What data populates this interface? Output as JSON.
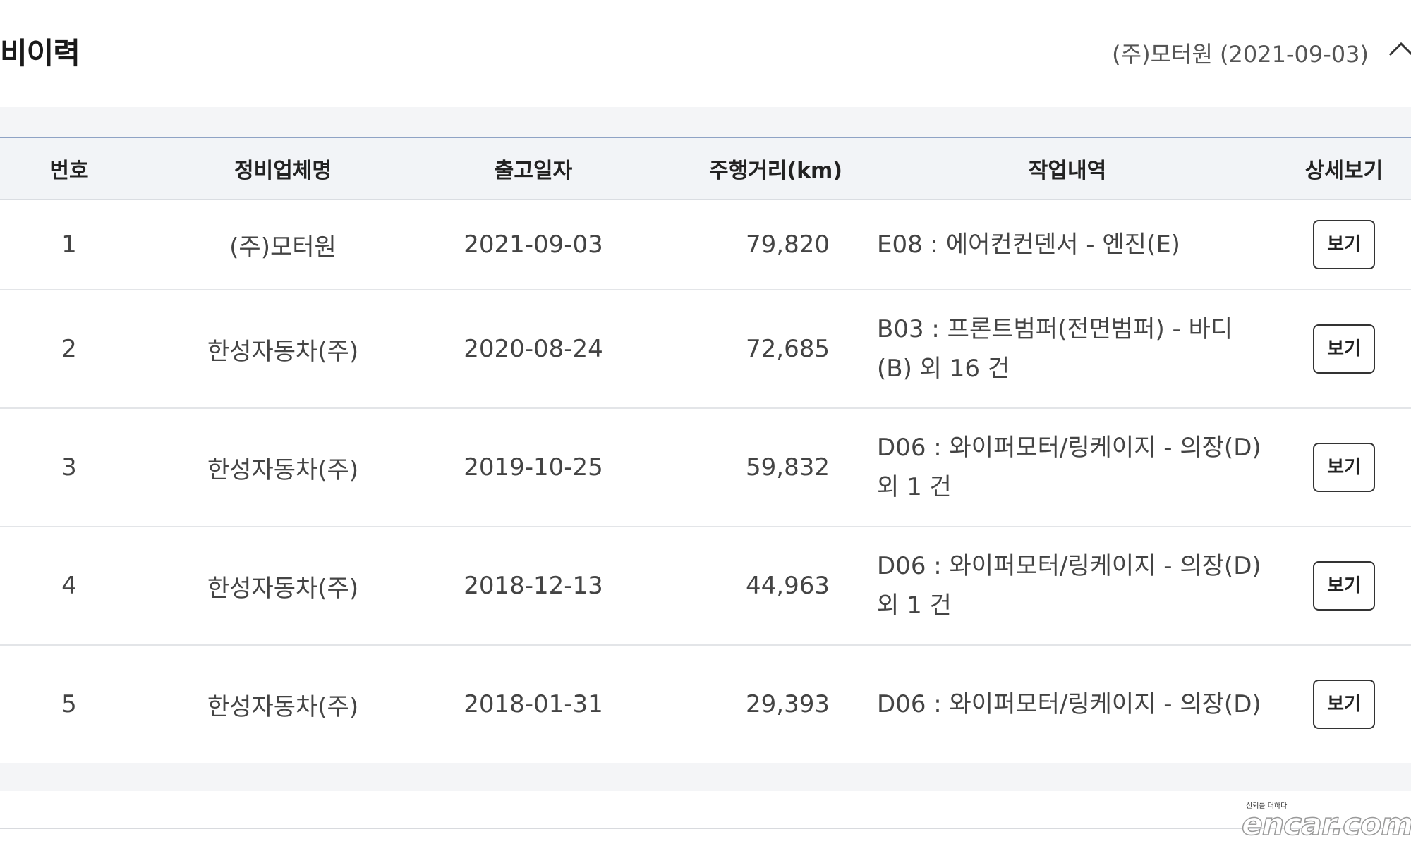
{
  "header": {
    "title": "비이력",
    "summary": "(주)모터원 (2021-09-03)",
    "toggle_icon": "chevron-up-icon"
  },
  "table": {
    "columns": [
      "번호",
      "정비업체명",
      "출고일자",
      "주행거리(km)",
      "작업내역",
      "상세보기"
    ],
    "rows": [
      {
        "no": "1",
        "shop": "(주)모터원",
        "date": "2021-09-03",
        "km": "79,820",
        "work": "E08 : 에어컨컨덴서 - 엔진(E)",
        "view": "보기"
      },
      {
        "no": "2",
        "shop": "한성자동차(주)",
        "date": "2020-08-24",
        "km": "72,685",
        "work": "B03 : 프론트범퍼(전면범퍼) - 바디(B) 외 16 건",
        "view": "보기"
      },
      {
        "no": "3",
        "shop": "한성자동차(주)",
        "date": "2019-10-25",
        "km": "59,832",
        "work": "D06 : 와이퍼모터/링케이지 - 의장(D) 외 1 건",
        "view": "보기"
      },
      {
        "no": "4",
        "shop": "한성자동차(주)",
        "date": "2018-12-13",
        "km": "44,963",
        "work": "D06 : 와이퍼모터/링케이지 - 의장(D) 외 1 건",
        "view": "보기"
      },
      {
        "no": "5",
        "shop": "한성자동차(주)",
        "date": "2018-01-31",
        "km": "29,393",
        "work": "D06 : 와이퍼모터/링케이지 - 의장(D)",
        "view": "보기"
      }
    ]
  },
  "watermark": {
    "tagline": "신뢰를 더하다",
    "logo": "encar.com"
  },
  "colors": {
    "header_bg": "#f2f4f7",
    "border_accent": "#8fa3c5",
    "band": "#f4f5f7"
  }
}
